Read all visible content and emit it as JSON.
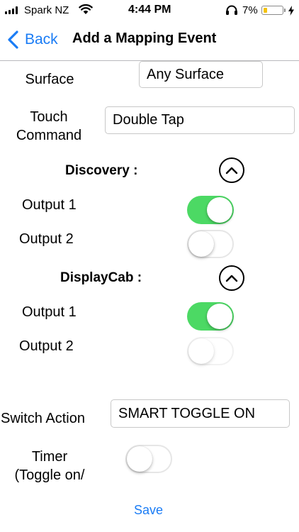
{
  "status_bar": {
    "carrier": "Spark NZ",
    "time": "4:44 PM",
    "battery_percent": "7%",
    "battery_color": "#f4c20d"
  },
  "nav": {
    "back_label": "Back",
    "title": "Add a Mapping Event",
    "accent_color": "#1a7cf5"
  },
  "form": {
    "surface": {
      "label": "Surface",
      "value": "Any Surface"
    },
    "touch_command": {
      "label_line1": "Touch",
      "label_line2": "Command",
      "value": "Double Tap"
    },
    "groups": [
      {
        "title": "Discovery :",
        "icon": "chevron-up-icon",
        "outputs": [
          {
            "label": "Output 1",
            "on": true
          },
          {
            "label": "Output 2",
            "on": false
          }
        ]
      },
      {
        "title": "DisplayCab :",
        "icon": "chevron-up-icon",
        "outputs": [
          {
            "label": "Output 1",
            "on": true
          },
          {
            "label": "Output 2",
            "on": false
          }
        ]
      }
    ],
    "switch_action": {
      "label": "Switch Action",
      "value": "SMART TOGGLE ON"
    },
    "timer": {
      "label_line1": "Timer",
      "label_line2": "(Toggle on/",
      "on": false
    },
    "save_label": "Save",
    "toggle_on_color": "#4cd964"
  }
}
